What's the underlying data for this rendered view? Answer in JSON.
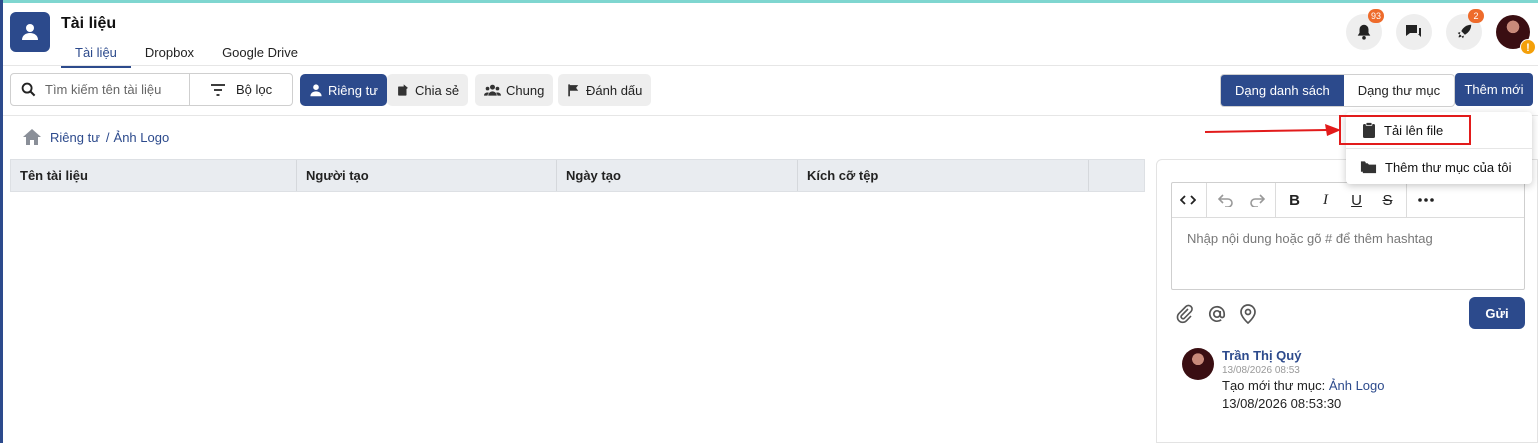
{
  "header": {
    "title": "Tài liệu",
    "tabs": [
      "Tài liệu",
      "Dropbox",
      "Google Drive"
    ],
    "notifications_count": "93",
    "rocket_count": "2"
  },
  "toolbar": {
    "search_placeholder": "Tìm kiếm tên tài liệu",
    "filter_label": "Bộ lọc",
    "chips": {
      "private": "Riêng tư",
      "shared": "Chia sẻ",
      "common": "Chung",
      "bookmark": "Đánh dấu"
    },
    "view_list": "Dạng danh sách",
    "view_folder": "Dạng thư mục",
    "add_new": "Thêm mới"
  },
  "breadcrumb": {
    "root": "Riêng tư",
    "separator": "/",
    "current": "Ảnh Logo"
  },
  "table": {
    "columns": [
      "Tên tài liệu",
      "Người tạo",
      "Ngày tạo",
      "Kích cỡ tệp"
    ]
  },
  "dropdown": {
    "upload_file": "Tải lên file",
    "add_folder": "Thêm thư mục của tôi"
  },
  "comment": {
    "placeholder": "Nhập nội dung hoặc gõ # để thêm hashtag",
    "send_label": "Gửi"
  },
  "activity": {
    "user": "Trần Thị Quý",
    "time_small": "13/08/2026 08:53",
    "text_prefix": "Tạo mới thư mục:",
    "link": "Ảnh Logo",
    "time_full": "13/08/2026 08:53:30"
  },
  "colors": {
    "primary": "#2c4a8c",
    "badge": "#ee6b2b",
    "highlight": "#e21b1b"
  }
}
